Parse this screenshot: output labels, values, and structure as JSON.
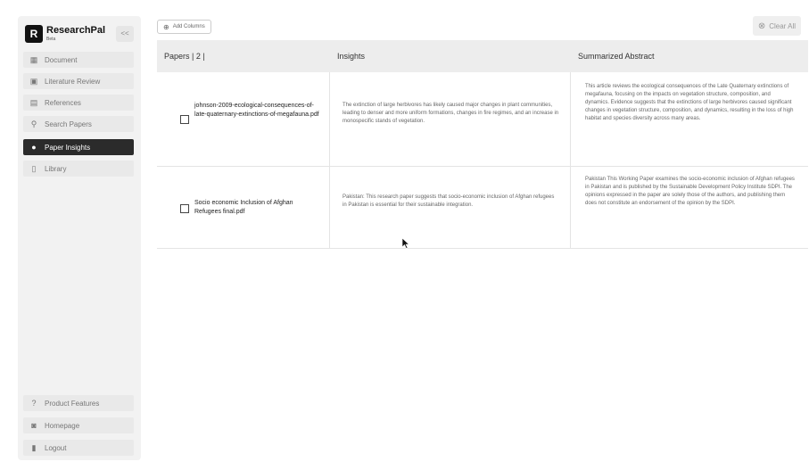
{
  "brand": {
    "name": "ResearchPal",
    "sub": "Beta",
    "collapse": "<<"
  },
  "sidebar": {
    "items": [
      {
        "label": "Document",
        "icon": "document-icon"
      },
      {
        "label": "Literature Review",
        "icon": "review-icon"
      },
      {
        "label": "References",
        "icon": "references-icon"
      },
      {
        "label": "Search Papers",
        "icon": "search-icon"
      },
      {
        "label": "Paper Insights",
        "icon": "bulb-icon",
        "active": true
      },
      {
        "label": "Library",
        "icon": "library-icon"
      }
    ],
    "bottom": [
      {
        "label": "Product Features",
        "icon": "question-icon"
      },
      {
        "label": "Homepage",
        "icon": "home-icon"
      },
      {
        "label": "Logout",
        "icon": "logout-icon"
      }
    ]
  },
  "toolbar": {
    "add_columns": "Add Columns",
    "clear_all": "Clear All"
  },
  "table": {
    "headers": [
      "Papers | 2 |",
      "Insights",
      "Summarized Abstract"
    ],
    "rows": [
      {
        "paper": "johnson-2009-ecological-consequences-of-late-quaternary-extinctions-of-megafauna.pdf",
        "insight": "The extinction of large herbivores has likely caused major changes in plant communities, leading to denser and more uniform formations, changes in fire regimes, and an increase in monospecific stands of vegetation.",
        "abstract": "This article reviews the ecological consequences of the Late Quaternary extinctions of megafauna, focusing on the impacts on vegetation structure, composition, and dynamics. Evidence suggests that the extinctions of large herbivores caused significant changes in vegetation structure, composition, and dynamics, resulting in the loss of high habitat and species diversity across many areas."
      },
      {
        "paper": "Socio economic Inclusion of Afghan Refugees final.pdf",
        "insight": "Pakistan: This research paper suggests that socio-economic inclusion of Afghan refugees in Pakistan is essential for their sustainable integration.",
        "abstract": "Pakistan This Working Paper examines the socio-economic inclusion of Afghan refugees in Pakistan and is published by the Sustainable Development Policy Institute SDPI. The opinions expressed in the paper are solely those of the authors, and publishing them does not constitute an endorsement of the opinion by the SDPI."
      }
    ]
  }
}
